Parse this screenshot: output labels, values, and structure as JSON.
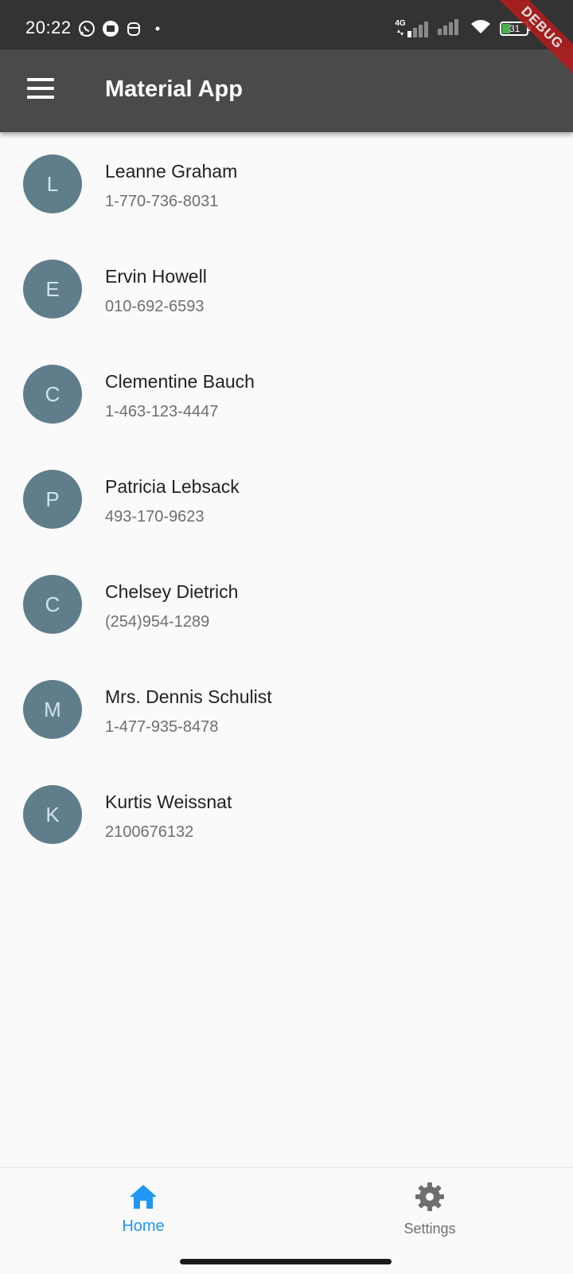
{
  "status_bar": {
    "time": "20:22",
    "network_label": "4G",
    "battery_level": "31",
    "left_icons": [
      "whatsapp-icon",
      "message-icon",
      "robot-icon",
      "dot-icon"
    ],
    "right_icons": [
      "signal-4g-icon",
      "signal-icon",
      "wifi-icon",
      "battery-icon"
    ]
  },
  "debug_banner": "DEBUG",
  "app_bar": {
    "title": "Material App",
    "menu_icon": "menu-icon"
  },
  "contacts": [
    {
      "initial": "L",
      "name": "Leanne Graham",
      "phone": "1-770-736-8031"
    },
    {
      "initial": "E",
      "name": "Ervin Howell",
      "phone": "010-692-6593"
    },
    {
      "initial": "C",
      "name": "Clementine Bauch",
      "phone": "1-463-123-4447"
    },
    {
      "initial": "P",
      "name": "Patricia Lebsack",
      "phone": "493-170-9623"
    },
    {
      "initial": "C",
      "name": "Chelsey Dietrich",
      "phone": "(254)954-1289"
    },
    {
      "initial": "M",
      "name": "Mrs. Dennis Schulist",
      "phone": "1-477-935-8478"
    },
    {
      "initial": "K",
      "name": "Kurtis Weissnat",
      "phone": "2100676132"
    }
  ],
  "bottom_nav": {
    "items": [
      {
        "label": "Home",
        "icon": "home-icon",
        "selected": true
      },
      {
        "label": "Settings",
        "icon": "gear-icon",
        "selected": false
      }
    ]
  },
  "colors": {
    "status_bar": "#333333",
    "app_bar": "#4a4a4a",
    "avatar": "#607d8b",
    "active_nav": "#2196f3",
    "inactive_nav": "#6f6f6f",
    "debug_banner": "#b71c1c"
  }
}
